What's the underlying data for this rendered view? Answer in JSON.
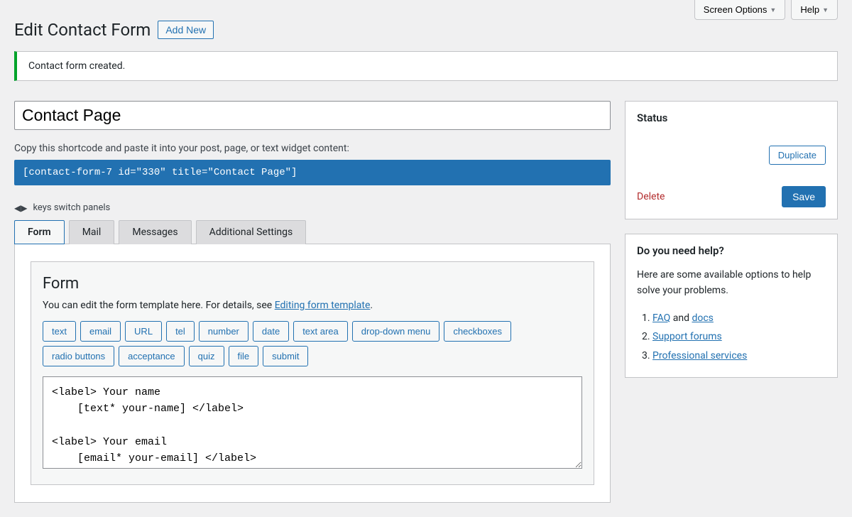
{
  "topButtons": {
    "screenOptions": "Screen Options",
    "help": "Help"
  },
  "header": {
    "title": "Edit Contact Form",
    "addNew": "Add New"
  },
  "notice": "Contact form created.",
  "form": {
    "titleValue": "Contact Page",
    "shortcodeLabel": "Copy this shortcode and paste it into your post, page, or text widget content:",
    "shortcode": "[contact-form-7 id=\"330\" title=\"Contact Page\"]",
    "keysHint": "keys switch panels"
  },
  "tabs": [
    "Form",
    "Mail",
    "Messages",
    "Additional Settings"
  ],
  "formPanel": {
    "heading": "Form",
    "descPrefix": "You can edit the form template here. For details, see ",
    "descLink": "Editing form template",
    "tagButtons": [
      "text",
      "email",
      "URL",
      "tel",
      "number",
      "date",
      "text area",
      "drop-down menu",
      "checkboxes",
      "radio buttons",
      "acceptance",
      "quiz",
      "file",
      "submit"
    ],
    "template": "<label> Your name\n    [text* your-name] </label>\n\n<label> Your email\n    [email* your-email] </label>"
  },
  "status": {
    "heading": "Status",
    "duplicate": "Duplicate",
    "delete": "Delete",
    "save": "Save"
  },
  "helpBox": {
    "heading": "Do you need help?",
    "desc": "Here are some available options to help solve your problems.",
    "items": [
      {
        "prefix": "",
        "link": "FAQ",
        "mid": " and ",
        "link2": "docs"
      },
      {
        "prefix": "",
        "link": "Support forums"
      },
      {
        "prefix": "",
        "link": "Professional services"
      }
    ]
  }
}
